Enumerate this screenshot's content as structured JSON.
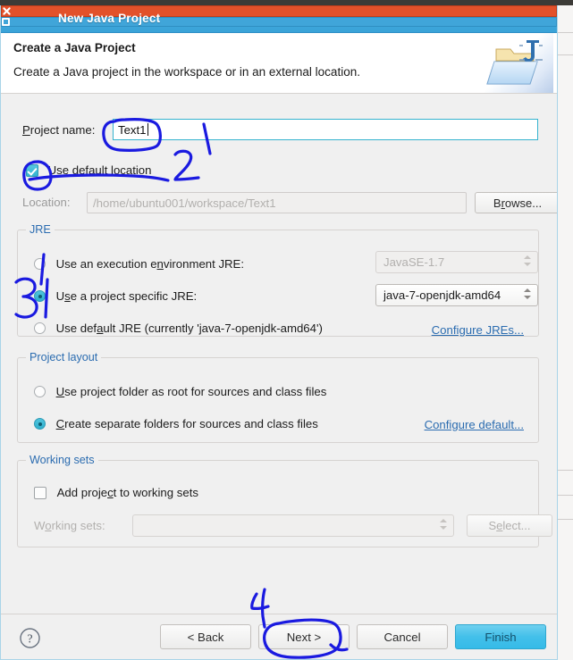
{
  "window": {
    "title": "New Java Project",
    "close_icon": "close-icon",
    "maximize_icon": "maximize-icon"
  },
  "header": {
    "title": "Create a Java Project",
    "description": "Create a Java project in the workspace or in an external location.",
    "icon": "java-project-folder-icon"
  },
  "form": {
    "project_name_label": "Project name:",
    "project_name_value": "Text1",
    "use_default_location_label": "Use default location",
    "use_default_location_checked": true,
    "location_label": "Location:",
    "location_value": "/home/ubuntu001/workspace/Text1",
    "browse_label": "Browse..."
  },
  "jre": {
    "group_title": "JRE",
    "option_execution_env": "Use an execution environment JRE:",
    "option_project_specific": "Use a project specific JRE:",
    "option_default": "Use default JRE (currently 'java-7-openjdk-amd64')",
    "selected": "project_specific",
    "execution_env_value": "JavaSE-1.7",
    "project_specific_value": "java-7-openjdk-amd64",
    "configure_link": "Configure JREs..."
  },
  "project_layout": {
    "group_title": "Project layout",
    "option_root": "Use project folder as root for sources and class files",
    "option_separate": "Create separate folders for sources and class files",
    "selected": "separate",
    "configure_link": "Configure default..."
  },
  "working_sets": {
    "group_title": "Working sets",
    "add_label": "Add project to working sets",
    "add_checked": false,
    "sets_label": "Working sets:",
    "sets_value": "",
    "select_label": "Select..."
  },
  "footer": {
    "help_icon": "help-icon",
    "back_label": "< Back",
    "next_label": "Next >",
    "cancel_label": "Cancel",
    "finish_label": "Finish"
  },
  "annotations": {
    "color": "#1a1ae0",
    "marks": [
      {
        "id": "1",
        "label": "1",
        "target": "project-name-field"
      },
      {
        "id": "2",
        "label": "2",
        "target": "use-default-location-checkbox"
      },
      {
        "id": "3",
        "label": "3",
        "target": "jre-project-specific-radio"
      },
      {
        "id": "4",
        "label": "4",
        "target": "next-button"
      }
    ]
  },
  "colors": {
    "titlebar": "#3fa8dc",
    "accent": "#35bbe8",
    "close_button": "#e2512a",
    "link": "#2b6cb0",
    "annotation": "#1a1ae0"
  }
}
